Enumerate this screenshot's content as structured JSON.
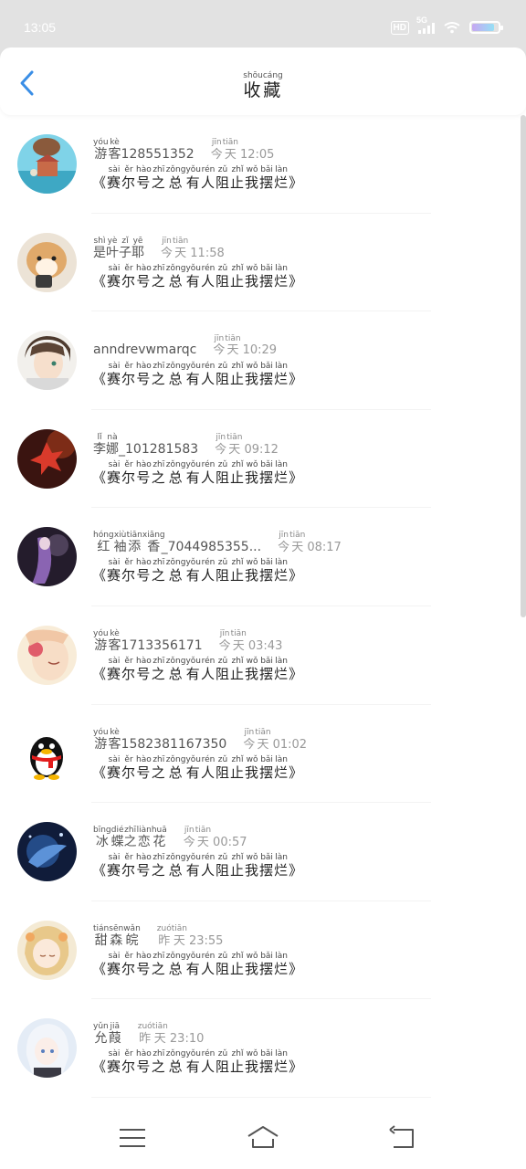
{
  "status": {
    "time": "13:05",
    "network": "5G",
    "hd": "HD",
    "battery_level": 0.92
  },
  "header": {
    "title_chars": [
      {
        "c": "收",
        "p": "shōu"
      },
      {
        "c": "藏",
        "p": "cáng"
      }
    ],
    "title_pinyin": "shōucáng"
  },
  "message_chars": [
    {
      "c": "赛",
      "p": "sài"
    },
    {
      "c": "尔",
      "p": "ěr"
    },
    {
      "c": "号",
      "p": "hào"
    },
    {
      "c": "之",
      "p": "zhī"
    },
    {
      "c": "总",
      "p": "zǒng"
    },
    {
      "c": "有",
      "p": "yǒu"
    },
    {
      "c": "人",
      "p": "rén"
    },
    {
      "c": "阻",
      "p": "zǔ"
    },
    {
      "c": "止",
      "p": "zhǐ"
    },
    {
      "c": "我",
      "p": "wǒ"
    },
    {
      "c": "摆",
      "p": "bǎi"
    },
    {
      "c": "烂",
      "p": "làn"
    }
  ],
  "items": [
    {
      "name": [
        {
          "c": "游",
          "p": "yóu"
        },
        {
          "c": "客",
          "p": "kè"
        }
      ],
      "name_suffix": "128551352",
      "time_prefix": [
        {
          "c": "今",
          "p": "jīn"
        },
        {
          "c": "天",
          "p": "tiān"
        }
      ],
      "time": "12:05",
      "avatar": "balloon-house"
    },
    {
      "name": [
        {
          "c": "是",
          "p": "shì"
        },
        {
          "c": "叶",
          "p": "yè"
        },
        {
          "c": "子",
          "p": "zǐ"
        },
        {
          "c": "耶",
          "p": "yē"
        }
      ],
      "name_suffix": "",
      "time_prefix": [
        {
          "c": "今",
          "p": "jīn"
        },
        {
          "c": "天",
          "p": "tiān"
        }
      ],
      "time": "11:58",
      "avatar": "shiba-dog"
    },
    {
      "name": [],
      "name_suffix": "anndrevwmarqc",
      "time_prefix": [
        {
          "c": "今",
          "p": "jīn"
        },
        {
          "c": "天",
          "p": "tiān"
        }
      ],
      "time": "10:29",
      "avatar": "anime-boy"
    },
    {
      "name": [
        {
          "c": "李",
          "p": "lǐ"
        },
        {
          "c": "娜",
          "p": "nà"
        }
      ],
      "name_suffix": "_101281583",
      "time_prefix": [
        {
          "c": "今",
          "p": "jīn"
        },
        {
          "c": "天",
          "p": "tiān"
        }
      ],
      "time": "09:12",
      "avatar": "red-leaf"
    },
    {
      "name": [
        {
          "c": "红",
          "p": "hóng"
        },
        {
          "c": "袖",
          "p": "xiù"
        },
        {
          "c": "添",
          "p": "tiān"
        },
        {
          "c": "香",
          "p": "xiāng"
        }
      ],
      "name_suffix": "_7044985355...",
      "time_prefix": [
        {
          "c": "今",
          "p": "jīn"
        },
        {
          "c": "天",
          "p": "tiān"
        }
      ],
      "time": "08:17",
      "avatar": "purple-figure"
    },
    {
      "name": [
        {
          "c": "游",
          "p": "yóu"
        },
        {
          "c": "客",
          "p": "kè"
        }
      ],
      "name_suffix": "1713356171",
      "time_prefix": [
        {
          "c": "今",
          "p": "jīn"
        },
        {
          "c": "天",
          "p": "tiān"
        }
      ],
      "time": "03:43",
      "avatar": "pink-anime-girl"
    },
    {
      "name": [
        {
          "c": "游",
          "p": "yóu"
        },
        {
          "c": "客",
          "p": "kè"
        }
      ],
      "name_suffix": "1582381167350",
      "time_prefix": [
        {
          "c": "今",
          "p": "jīn"
        },
        {
          "c": "天",
          "p": "tiān"
        }
      ],
      "time": "01:02",
      "avatar": "qq-penguin"
    },
    {
      "name": [
        {
          "c": "冰",
          "p": "bīng"
        },
        {
          "c": "蝶",
          "p": "dié"
        },
        {
          "c": "之",
          "p": "zhī"
        },
        {
          "c": "恋",
          "p": "liàn"
        },
        {
          "c": "花",
          "p": "huā"
        }
      ],
      "name_suffix": "",
      "time_prefix": [
        {
          "c": "今",
          "p": "jīn"
        },
        {
          "c": "天",
          "p": "tiān"
        }
      ],
      "time": "00:57",
      "avatar": "blue-night"
    },
    {
      "name": [
        {
          "c": "甜",
          "p": "tián"
        },
        {
          "c": "森",
          "p": "sēn"
        },
        {
          "c": "皖",
          "p": "wǎn"
        }
      ],
      "name_suffix": "",
      "time_prefix": [
        {
          "c": "昨",
          "p": "zuó"
        },
        {
          "c": "天",
          "p": "tiān"
        }
      ],
      "time": "23:55",
      "avatar": "golden-anime-girl"
    },
    {
      "name": [
        {
          "c": "允",
          "p": "yǔn"
        },
        {
          "c": "葭",
          "p": "jiā"
        }
      ],
      "name_suffix": "",
      "time_prefix": [
        {
          "c": "昨",
          "p": "zuó"
        },
        {
          "c": "天",
          "p": "tiān"
        }
      ],
      "time": "23:10",
      "avatar": "white-hair-anime"
    }
  ],
  "colors": {
    "accent": "#3a8ee6",
    "statusbar": "#e2e2e2",
    "divider": "#f3f3f3"
  }
}
